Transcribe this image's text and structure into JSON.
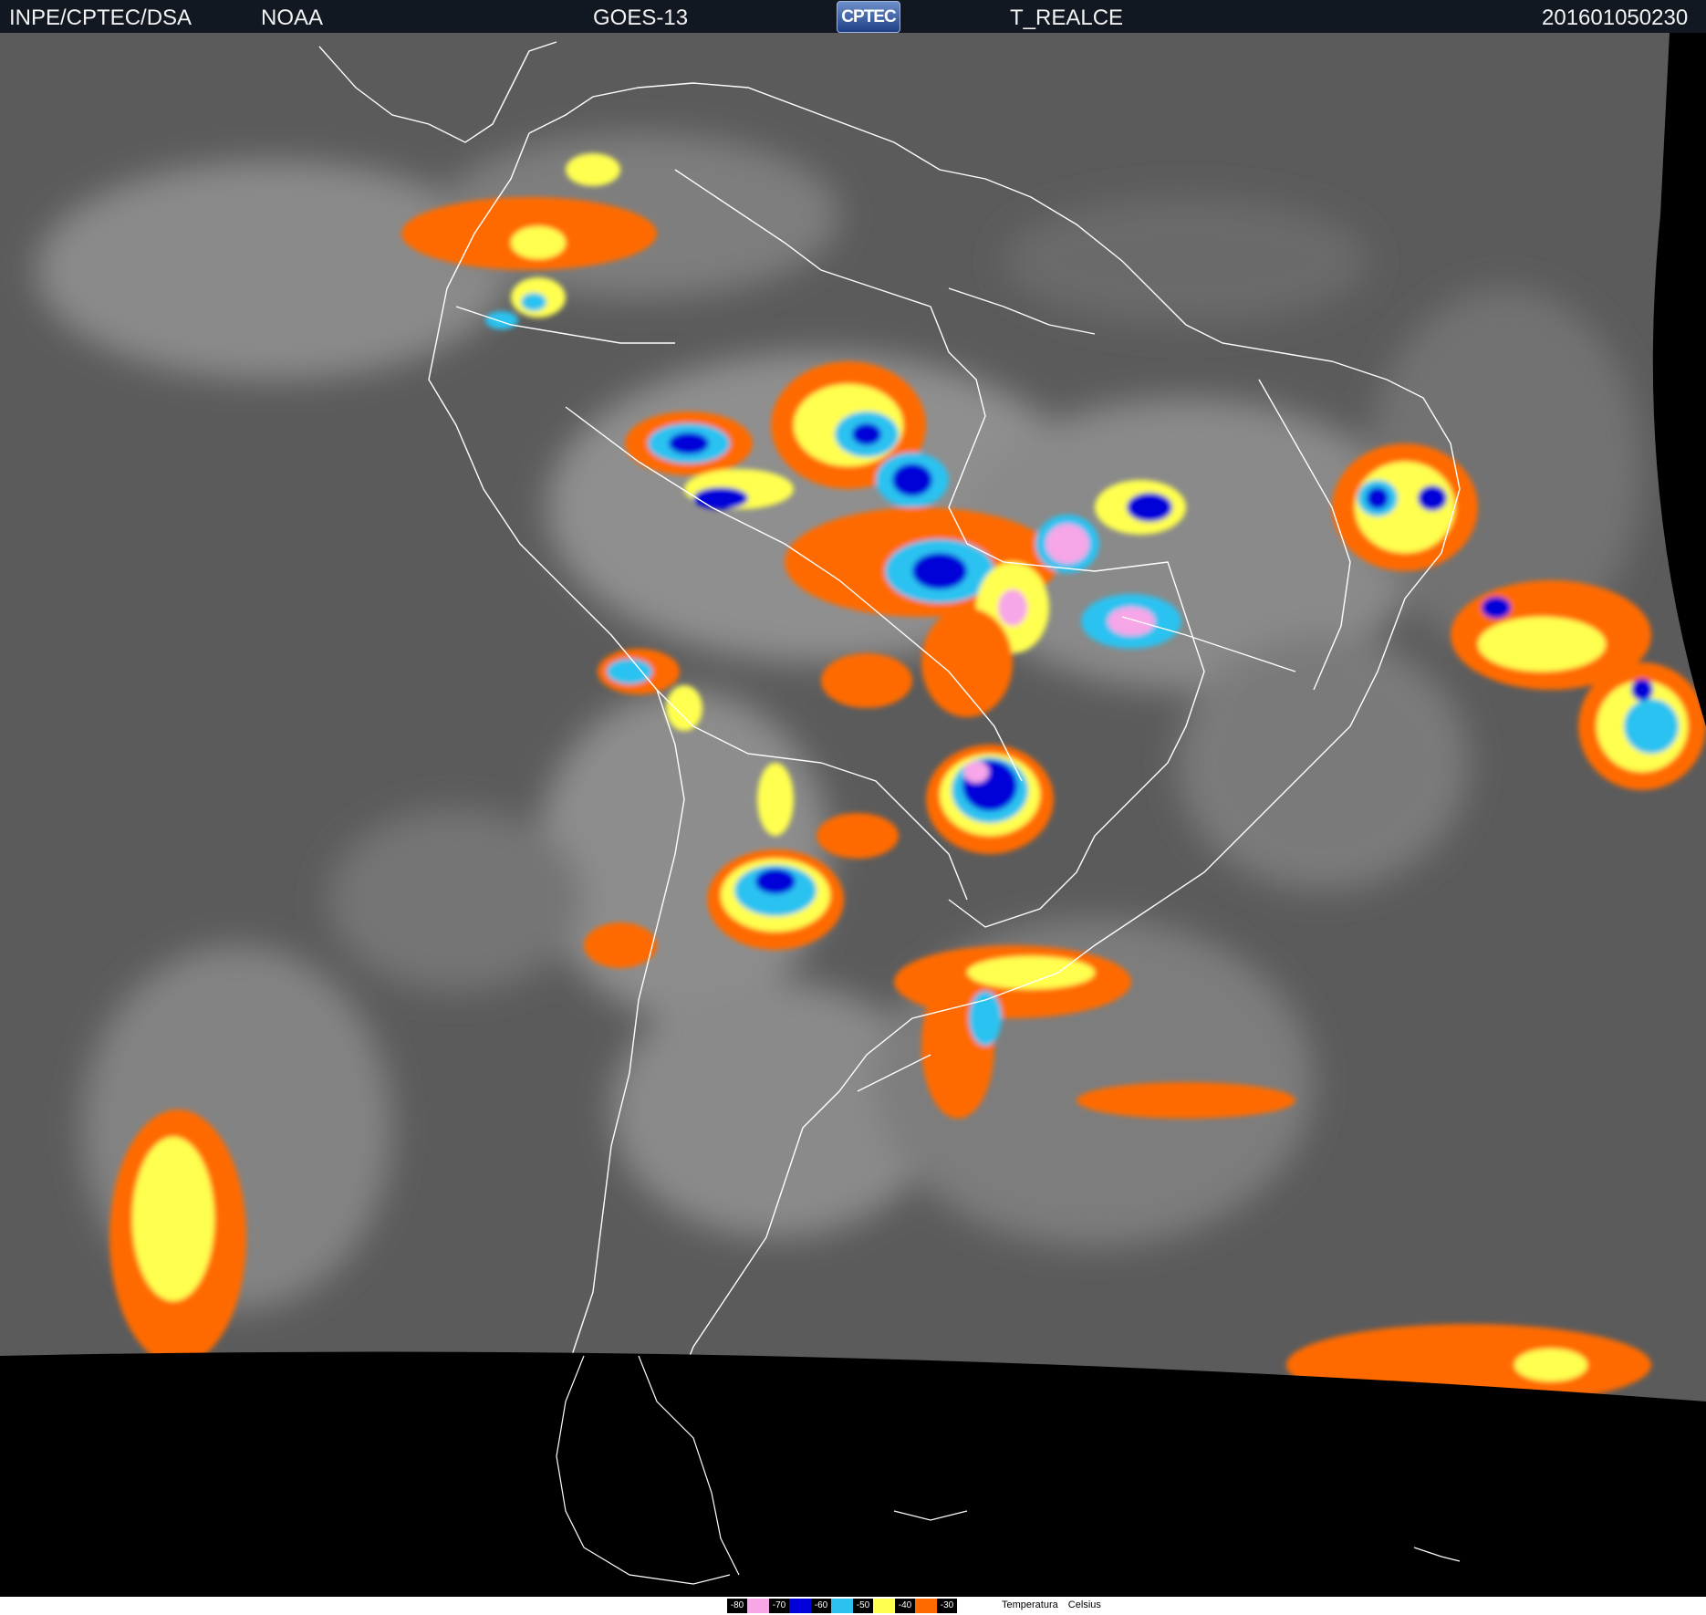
{
  "header": {
    "left_org": "INPE/CPTEC/DSA",
    "agency": "NOAA",
    "satellite": "GOES-13",
    "logo_text": "CPTEC",
    "product": "T_REALCE",
    "timestamp": "201601050230"
  },
  "legend": {
    "items": [
      {
        "label": "-80",
        "color": "#f7a6e8"
      },
      {
        "label": "-70",
        "color": "#0000d8"
      },
      {
        "label": "-60",
        "color": "#2cc2f0"
      },
      {
        "label": "-50",
        "color": "#ffff50"
      },
      {
        "label": "-40",
        "color": "#ff6a00"
      },
      {
        "label": "-30",
        "color": "#ff6a00"
      }
    ],
    "caption": "Temperatura Celsius"
  },
  "map": {
    "colors": {
      "cloud_gray": "#5b5b5b",
      "no_data": "#000000",
      "borders": "#ffffff"
    }
  }
}
